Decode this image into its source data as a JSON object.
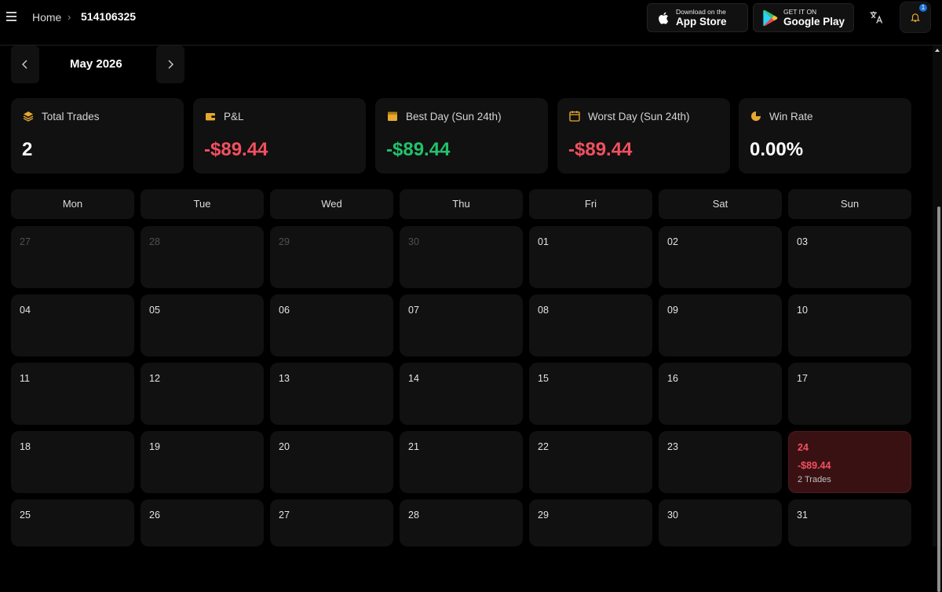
{
  "header": {
    "breadcrumb": {
      "home": "Home",
      "current": "514106325"
    },
    "app_store": {
      "small": "Download on the",
      "big": "App Store"
    },
    "google_play": {
      "small": "GET IT ON",
      "big": "Google Play"
    },
    "notification_count": "1"
  },
  "calendar": {
    "month_label": "May 2026"
  },
  "stats": [
    {
      "label": "Total Trades",
      "value": "2",
      "icon": "layers-icon",
      "tone": "white"
    },
    {
      "label": "P&L",
      "value": "-$89.44",
      "icon": "wallet-icon",
      "tone": "red"
    },
    {
      "label": "Best Day (Sun 24th)",
      "value": "-$89.44",
      "icon": "calendar-icon",
      "tone": "green"
    },
    {
      "label": "Worst Day (Sun 24th)",
      "value": "-$89.44",
      "icon": "calendar-icon",
      "tone": "red"
    },
    {
      "label": "Win Rate",
      "value": "0.00%",
      "icon": "pie-chart-icon",
      "tone": "white"
    }
  ],
  "weekdays": [
    "Mon",
    "Tue",
    "Wed",
    "Thu",
    "Fri",
    "Sat",
    "Sun"
  ],
  "days": [
    [
      "27",
      "28",
      "29",
      "30",
      "01",
      "02",
      "03"
    ],
    [
      "04",
      "05",
      "06",
      "07",
      "08",
      "09",
      "10"
    ],
    [
      "11",
      "12",
      "13",
      "14",
      "15",
      "16",
      "17"
    ],
    [
      "18",
      "19",
      "20",
      "21",
      "22",
      "23",
      "24"
    ],
    [
      "25",
      "26",
      "27",
      "28",
      "29",
      "30",
      "31"
    ]
  ],
  "highlight": {
    "day": "24",
    "pnl": "-$89.44",
    "trades": "2 Trades"
  },
  "colors": {
    "accent": "#e6a82e",
    "loss": "#f2505f",
    "gain": "#22c26b",
    "loss_bg": "#3a1113"
  }
}
